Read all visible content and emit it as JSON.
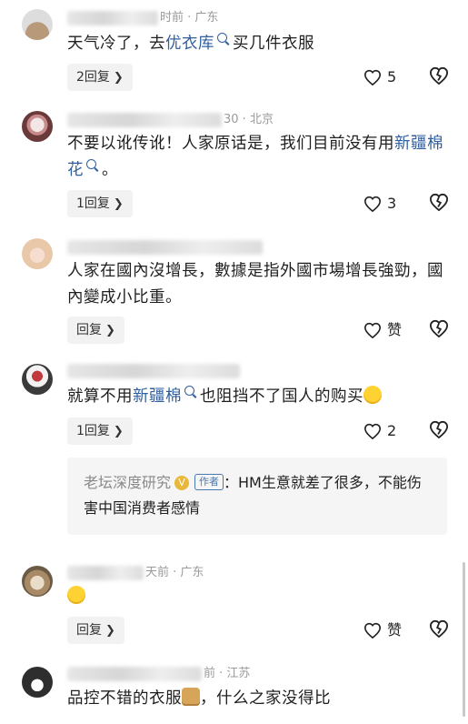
{
  "comments": [
    {
      "meta_tail": "时前 · 广东",
      "text_before": "天气冷了，去",
      "link": "优衣库",
      "text_after": "买几件衣服",
      "reply_label": "2回复",
      "like_count": "5"
    },
    {
      "meta_tail": "30 · 北京",
      "text_before": "不要以讹传讹！人家原话是，我们目前没有用",
      "link": "新疆棉花",
      "text_after": "。",
      "reply_label": "1回复",
      "like_count": "3"
    },
    {
      "text": "人家在國內沒增長，數據是指外國市場增長強勁，國內變成小比重。",
      "reply_label": "回复",
      "like_label": "赞"
    },
    {
      "text_before": "就算不用",
      "link": "新疆棉",
      "text_after": "也阻挡不了国人的购买",
      "reply_label": "1回复",
      "like_count": "2",
      "author_reply": {
        "name": "老坛深度研究",
        "badge": "V",
        "tag": "作者",
        "text": "：HM生意就差了很多，不能伤害中国消费者感情"
      }
    },
    {
      "meta_tail": "天前 · 广东",
      "reply_label": "回复",
      "like_label": "赞"
    },
    {
      "meta_tail": "前 · 江苏",
      "text_before": "品控不错的衣服",
      "text_after": "，什么之家没得比"
    }
  ],
  "icons": {
    "reply_chevron": "chevron-right-icon",
    "like": "heart-icon",
    "dislike": "broken-heart-icon",
    "search": "search-icon"
  },
  "colors": {
    "link": "#2f5fa0",
    "reply_bg": "#f2f2f2",
    "meta": "#9a9a9a"
  }
}
